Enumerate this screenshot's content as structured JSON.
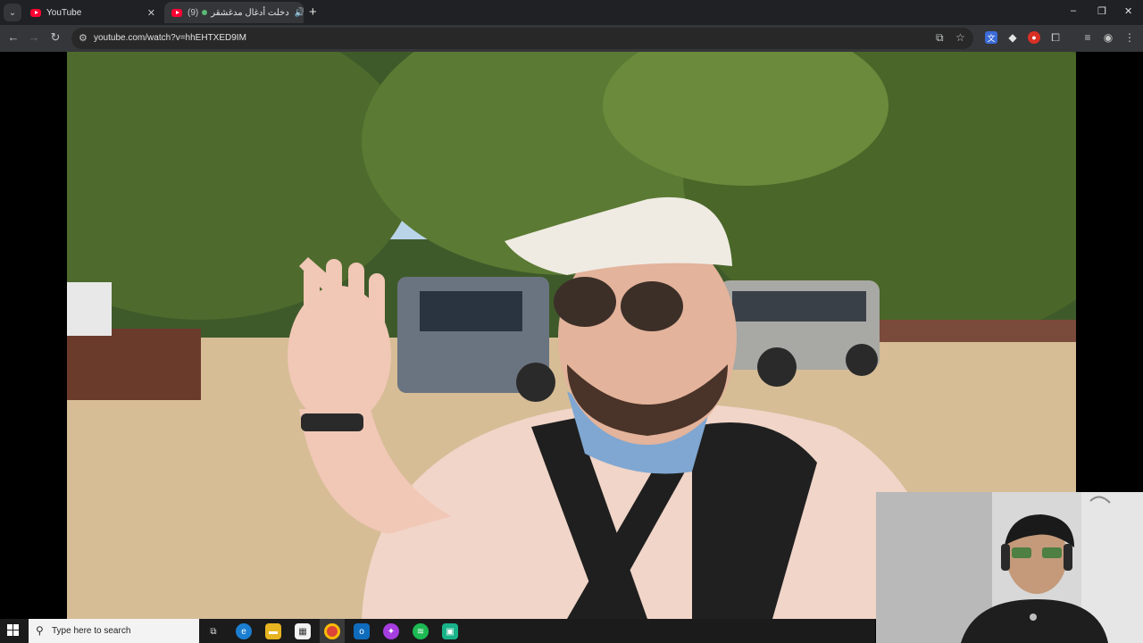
{
  "browser": {
    "tab_list_icon": "chevron-down-icon",
    "tabs": [
      {
        "title": "YouTube",
        "icon": "youtube-icon",
        "active": false
      },
      {
        "title": "دخلت أدغال مدغشقر",
        "prefix": "(9)",
        "icon": "youtube-icon",
        "audio_icon": "speaker-icon",
        "active": true
      }
    ],
    "new_tab_label": "+",
    "address": "youtube.com/watch?v=hhEHTXED9IM",
    "window_controls": {
      "minimize": "–",
      "restore": "❐",
      "close": "✕"
    }
  },
  "toolbar": {
    "back": "←",
    "forward": "→",
    "reload": "↻",
    "extensions": [
      "translate-icon",
      "diamond-icon",
      "record-icon",
      "puzzle-icon"
    ]
  },
  "taskbar": {
    "search_placeholder": "Type here to search",
    "apps": [
      "task-view-icon",
      "edge-icon",
      "file-explorer-icon",
      "store-icon",
      "chrome-icon",
      "outlook-icon",
      "messenger-icon",
      "spotify-icon",
      "android-icon"
    ]
  },
  "colors": {
    "youtube_red": "#ff0033",
    "chrome_dark": "#202124",
    "chrome_toolbar": "#35363a",
    "spotify_green": "#1db954"
  }
}
